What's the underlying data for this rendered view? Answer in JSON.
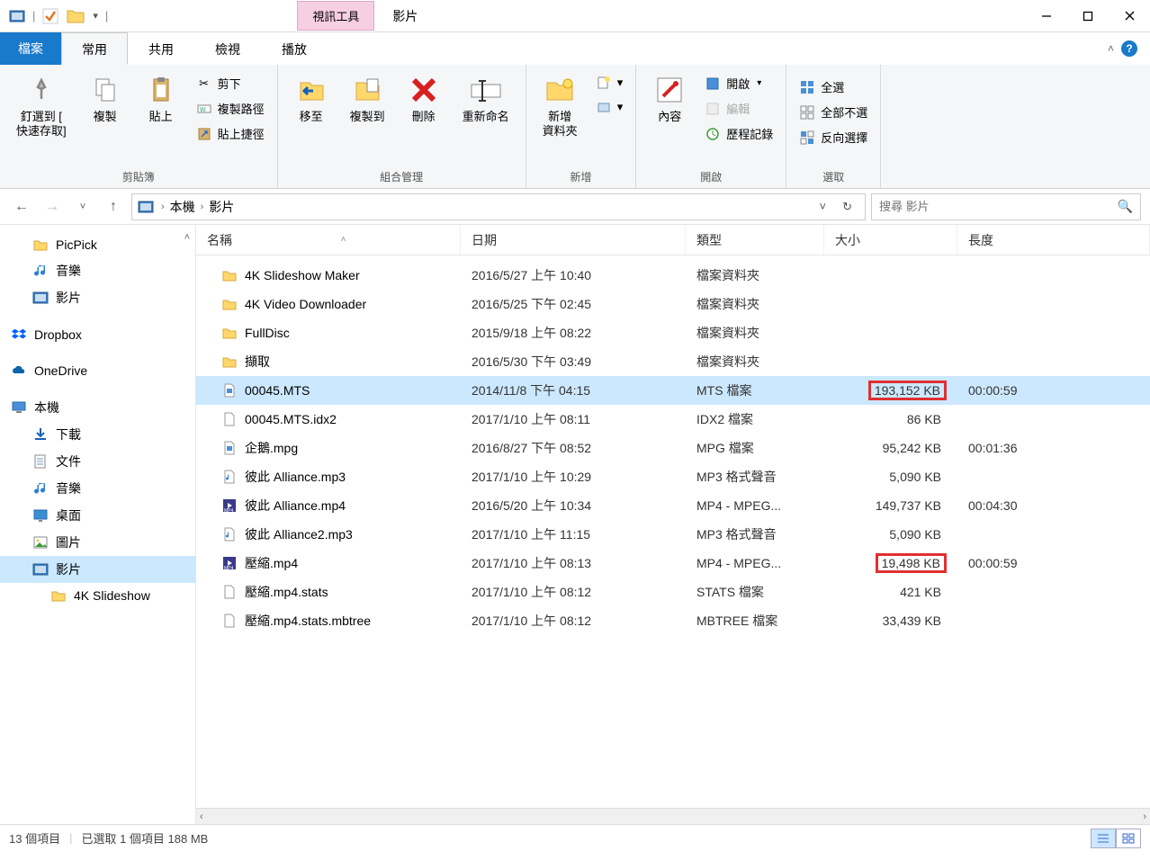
{
  "title": {
    "context_tool": "視訊工具",
    "context_title": "影片"
  },
  "tabs": {
    "file": "檔案",
    "home": "常用",
    "share": "共用",
    "view": "檢視",
    "play": "播放"
  },
  "ribbon": {
    "clipboard": {
      "pin": "釘選到 [\n快速存取]",
      "copy": "複製",
      "paste": "貼上",
      "cut": "剪下",
      "copy_path": "複製路徑",
      "paste_shortcut": "貼上捷徑",
      "label": "剪貼簿"
    },
    "organize": {
      "move_to": "移至",
      "copy_to": "複製到",
      "delete": "刪除",
      "rename": "重新命名",
      "label": "組合管理"
    },
    "new": {
      "new_folder": "新增\n資料夾",
      "label": "新增"
    },
    "open": {
      "properties": "內容",
      "open": "開啟",
      "edit": "編輯",
      "history": "歷程記錄",
      "label": "開啟"
    },
    "select": {
      "select_all": "全選",
      "select_none": "全部不選",
      "invert": "反向選擇",
      "label": "選取"
    }
  },
  "breadcrumb": {
    "root": "本機",
    "current": "影片"
  },
  "search": {
    "placeholder": "搜尋 影片"
  },
  "nav": [
    {
      "icon": "folder",
      "label": "PicPick",
      "indent": 1
    },
    {
      "icon": "music",
      "label": "音樂",
      "indent": 1
    },
    {
      "icon": "video",
      "label": "影片",
      "indent": 1
    },
    {
      "spacer": true
    },
    {
      "icon": "dropbox",
      "label": "Dropbox",
      "indent": 0
    },
    {
      "spacer": true
    },
    {
      "icon": "onedrive",
      "label": "OneDrive",
      "indent": 0
    },
    {
      "spacer": true
    },
    {
      "icon": "pc",
      "label": "本機",
      "indent": 0
    },
    {
      "icon": "download",
      "label": "下載",
      "indent": 1
    },
    {
      "icon": "document",
      "label": "文件",
      "indent": 1
    },
    {
      "icon": "music",
      "label": "音樂",
      "indent": 1
    },
    {
      "icon": "desktop",
      "label": "桌面",
      "indent": 1
    },
    {
      "icon": "picture",
      "label": "圖片",
      "indent": 1
    },
    {
      "icon": "video",
      "label": "影片",
      "indent": 1,
      "selected": true
    },
    {
      "icon": "folder",
      "label": "4K Slideshow",
      "indent": 2
    }
  ],
  "columns": {
    "name": "名稱",
    "date": "日期",
    "type": "類型",
    "size": "大小",
    "length": "長度"
  },
  "files": [
    {
      "icon": "folder",
      "name": "4K Slideshow Maker",
      "date": "2016/5/27 上午 10:40",
      "type": "檔案資料夾",
      "size": "",
      "length": ""
    },
    {
      "icon": "folder",
      "name": "4K Video Downloader",
      "date": "2016/5/25 下午 02:45",
      "type": "檔案資料夾",
      "size": "",
      "length": ""
    },
    {
      "icon": "folder",
      "name": "FullDisc",
      "date": "2015/9/18 上午 08:22",
      "type": "檔案資料夾",
      "size": "",
      "length": ""
    },
    {
      "icon": "folder",
      "name": "擷取",
      "date": "2016/5/30 下午 03:49",
      "type": "檔案資料夾",
      "size": "",
      "length": ""
    },
    {
      "icon": "video-file",
      "name": "00045.MTS",
      "date": "2014/11/8 下午 04:15",
      "type": "MTS 檔案",
      "size": "193,152 KB",
      "length": "00:00:59",
      "selected": true,
      "hl_size": true
    },
    {
      "icon": "file",
      "name": "00045.MTS.idx2",
      "date": "2017/1/10 上午 08:11",
      "type": "IDX2 檔案",
      "size": "86 KB",
      "length": ""
    },
    {
      "icon": "video-file",
      "name": "企鵝.mpg",
      "date": "2016/8/27 下午 08:52",
      "type": "MPG 檔案",
      "size": "95,242 KB",
      "length": "00:01:36"
    },
    {
      "icon": "audio-file",
      "name": "彼此 Alliance.mp3",
      "date": "2017/1/10 上午 10:29",
      "type": "MP3 格式聲音",
      "size": "5,090 KB",
      "length": ""
    },
    {
      "icon": "mp4-file",
      "name": "彼此 Alliance.mp4",
      "date": "2016/5/20 上午 10:34",
      "type": "MP4 - MPEG...",
      "size": "149,737 KB",
      "length": "00:04:30"
    },
    {
      "icon": "audio-file",
      "name": "彼此 Alliance2.mp3",
      "date": "2017/1/10 上午 11:15",
      "type": "MP3 格式聲音",
      "size": "5,090 KB",
      "length": ""
    },
    {
      "icon": "mp4-file",
      "name": "壓縮.mp4",
      "date": "2017/1/10 上午 08:13",
      "type": "MP4 - MPEG...",
      "size": "19,498 KB",
      "length": "00:00:59",
      "hl_size": true
    },
    {
      "icon": "file",
      "name": "壓縮.mp4.stats",
      "date": "2017/1/10 上午 08:12",
      "type": "STATS 檔案",
      "size": "421 KB",
      "length": ""
    },
    {
      "icon": "file",
      "name": "壓縮.mp4.stats.mbtree",
      "date": "2017/1/10 上午 08:12",
      "type": "MBTREE 檔案",
      "size": "33,439 KB",
      "length": ""
    }
  ],
  "status": {
    "count": "13 個項目",
    "selection": "已選取 1 個項目 188 MB"
  }
}
